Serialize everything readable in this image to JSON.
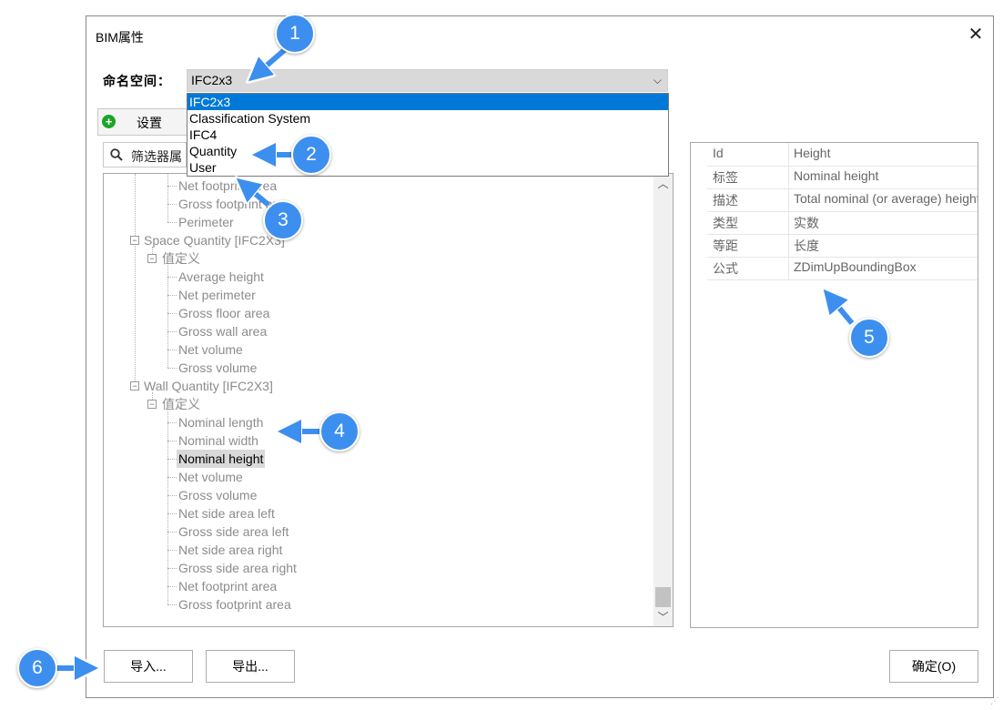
{
  "dialog": {
    "title": "BIM属性",
    "close_icon": "close-icon"
  },
  "namespace": {
    "label": "命名空间：",
    "selected": "IFC2x3",
    "options": [
      "IFC2x3",
      "Classification System",
      "IFC4",
      "Quantity",
      "User"
    ],
    "highlight_color": "#0078d7"
  },
  "toolbar": {
    "settings_label": "设置"
  },
  "filter": {
    "placeholder": "筛选器属"
  },
  "tree": {
    "items": [
      "Net footprint area",
      "Gross footprint area",
      "Perimeter",
      "Space Quantity [IFC2X3]",
      "值定义",
      "Average height",
      "Net perimeter",
      "Gross floor area",
      "Gross wall area",
      "Net volume",
      "Gross volume",
      "Wall Quantity [IFC2X3]",
      "值定义",
      "Nominal length",
      "Nominal width",
      "Nominal height",
      "Net volume",
      "Gross volume",
      "Net side area left",
      "Gross side area left",
      "Net side area right",
      "Gross side area right",
      "Net footprint area",
      "Gross footprint area"
    ],
    "selected_item": "Nominal height"
  },
  "properties": {
    "rows": [
      {
        "key": "Id",
        "value": "Height"
      },
      {
        "key": "标签",
        "value": "Nominal height"
      },
      {
        "key": "描述",
        "value": "Total nominal (or average) height"
      },
      {
        "key": "类型",
        "value": "实数"
      },
      {
        "key": "等距",
        "value": "长度"
      },
      {
        "key": "公式",
        "value": "ZDimUpBoundingBox"
      }
    ]
  },
  "buttons": {
    "import": "导入...",
    "export": "导出...",
    "ok": "确定(O)"
  },
  "callouts": [
    "1",
    "2",
    "3",
    "4",
    "5",
    "6"
  ],
  "colors": {
    "callout": "#3d8fef",
    "selection_grey": "#d9d9d9"
  }
}
